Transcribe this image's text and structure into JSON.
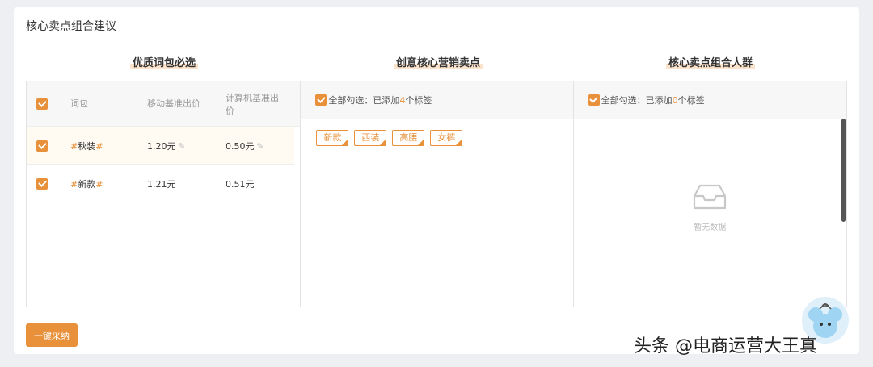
{
  "header": {
    "title": "核心卖点组合建议"
  },
  "columns": {
    "keywords": {
      "title": "优质词包必选",
      "headers": {
        "word": "词包",
        "mobile_bid": "移动基准出价",
        "pc_bid_line1": "计算机基准出",
        "pc_bid_line2": "价"
      },
      "rows": [
        {
          "hash_left": "#",
          "word": "秋装",
          "hash_right": "#",
          "mobile_bid": "1.20元",
          "pc_bid": "0.50元",
          "highlighted": true,
          "edit_icon": "pencil-icon"
        },
        {
          "hash_left": "#",
          "word": "新款",
          "hash_right": "#",
          "mobile_bid": "1.21元",
          "pc_bid": "0.51元",
          "highlighted": false
        }
      ]
    },
    "selling_points": {
      "title": "创意核心营销卖点",
      "select_all": {
        "prefix": "全部勾选：已添加",
        "count": "4",
        "suffix": "个标签"
      },
      "tags": [
        "新款",
        "西装",
        "高腰",
        "女裤"
      ]
    },
    "audience": {
      "title": "核心卖点组合人群",
      "select_all": {
        "prefix": "全部勾选：已添加",
        "count": "0",
        "suffix": "个标签"
      },
      "empty_text": "暂无数据",
      "empty_icon": "inbox-icon"
    }
  },
  "actions": {
    "adopt_label": "一键采纳"
  },
  "watermark": {
    "text": "头条 @电商运营大王真"
  },
  "colors": {
    "accent": "#e8913a",
    "highlight_row": "#fffbf3",
    "title_underline": "#fbe3cc"
  }
}
